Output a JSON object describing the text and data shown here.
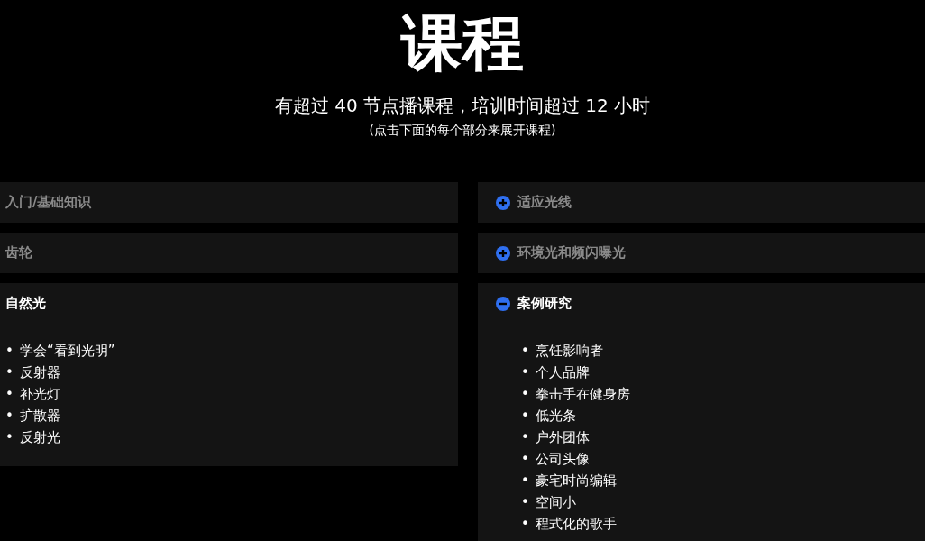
{
  "title": "课程",
  "subtitle": "有超过 40 节点播课程，培训时间超过 12 小时",
  "note": "(点击下面的每个部分来展开课程)",
  "columns": [
    {
      "show_icons": false,
      "sections": [
        {
          "title": "入门/基础知识",
          "expanded": false
        },
        {
          "title": "齿轮",
          "expanded": false
        },
        {
          "title": "自然光",
          "expanded": true,
          "items": [
            {
              "bullet": "•",
              "text": "学会“看到光明”"
            },
            {
              "bullet": "•",
              "text": "反射器"
            },
            {
              "bullet": "•",
              "text": "补光灯"
            },
            {
              "bullet": "•",
              "text": "扩散器"
            },
            {
              "bullet": "•",
              "text": "反射光"
            }
          ]
        }
      ]
    },
    {
      "show_icons": true,
      "sections": [
        {
          "title": "适应光线",
          "expanded": false
        },
        {
          "title": "环境光和频闪曝光",
          "expanded": false
        },
        {
          "title": "案例研究",
          "expanded": true,
          "items": [
            {
              "bullet": "•",
              "text": "烹饪影响者"
            },
            {
              "bullet": "•",
              "text": "个人品牌"
            },
            {
              "bullet": "•",
              "text": "拳击手在健身房"
            },
            {
              "bullet": "•",
              "text": "低光条"
            },
            {
              "bullet": "•",
              "text": "户外团体"
            },
            {
              "bullet": "•",
              "text": "公司头像"
            },
            {
              "bullet": "•",
              "text": "豪宅时尚编辑"
            },
            {
              "bullet": "•",
              "text": "空间小"
            },
            {
              "bullet": "•",
              "text": "程式化的歌手"
            }
          ]
        }
      ]
    }
  ]
}
